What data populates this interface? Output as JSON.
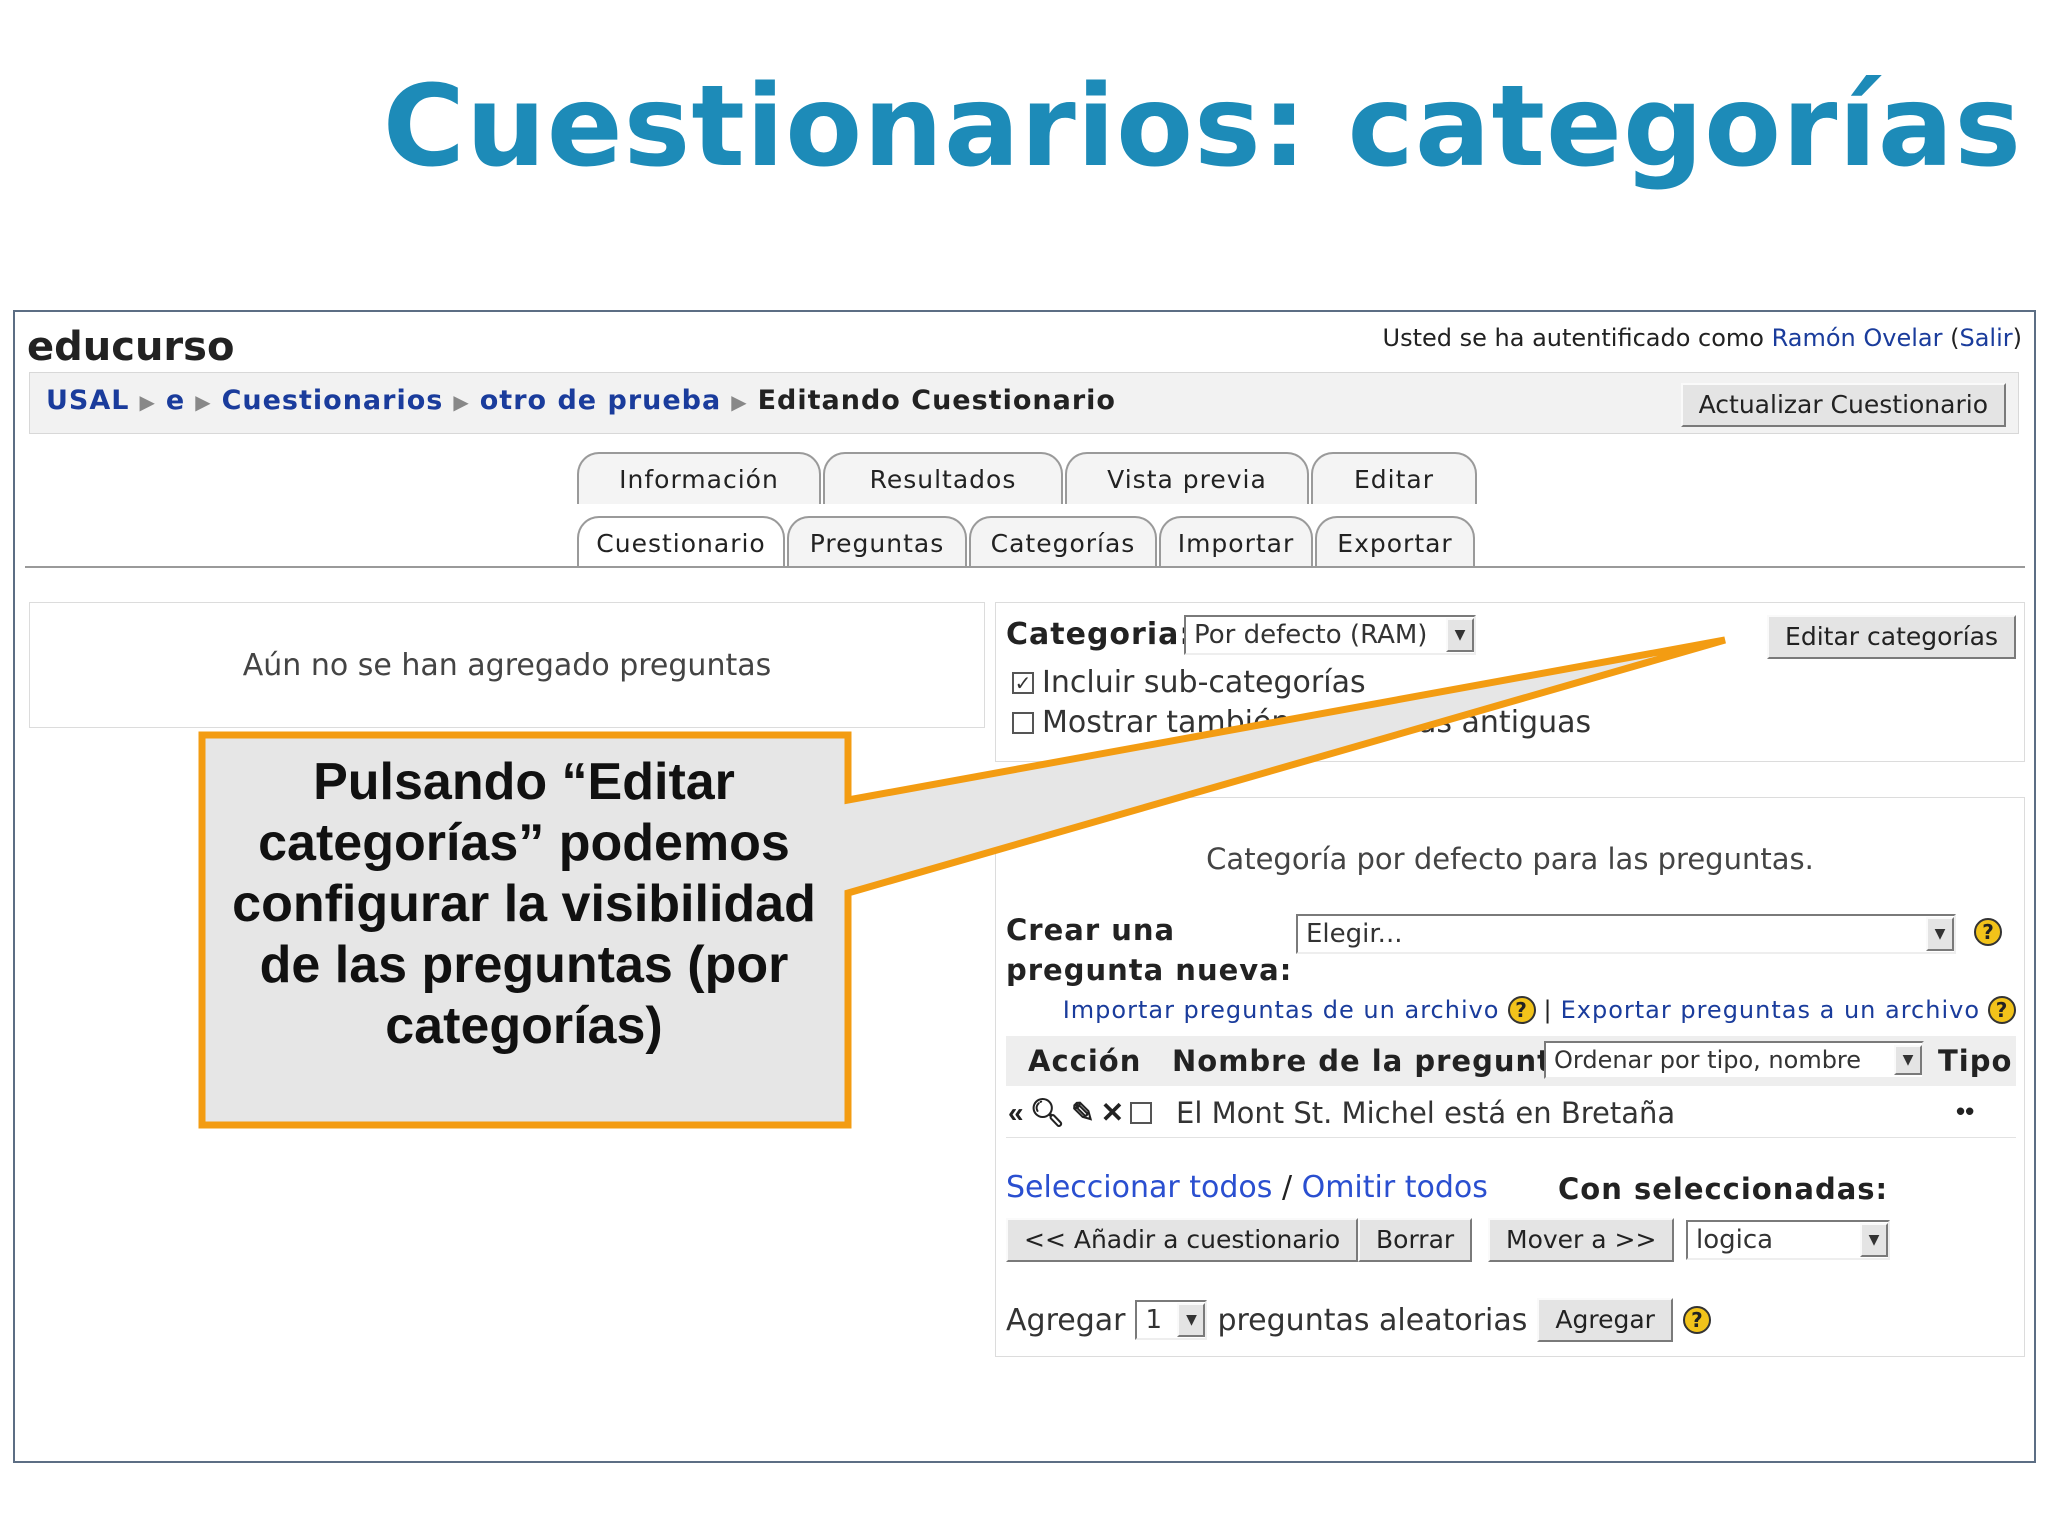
{
  "slide_title": "Cuestionarios: categorías",
  "site": {
    "name": "educurso",
    "login_prefix": "Usted se ha autentificado como",
    "user": "Ramón Ovelar",
    "logout": "Salir"
  },
  "breadcrumb": {
    "items": [
      "USAL",
      "e",
      "Cuestionarios",
      "otro de prueba"
    ],
    "current": "Editando Cuestionario",
    "separator": "▶"
  },
  "update_button": "Actualizar Cuestionario",
  "tabs_top": [
    "Información",
    "Resultados",
    "Vista previa",
    "Editar"
  ],
  "tabs_bottom": [
    "Cuestionario",
    "Preguntas",
    "Categorías",
    "Importar",
    "Exportar"
  ],
  "active_tab": "Cuestionario",
  "no_questions": "Aún no se han agregado preguntas",
  "category": {
    "label": "Categoria:",
    "selected": "Por defecto (RAM)",
    "edit_button": "Editar categorías",
    "include_sub": "Incluir sub-categorías",
    "include_sub_checked": true,
    "show_old": "Mostrar también preguntas antiguas",
    "show_old_checked": false
  },
  "questions": {
    "default_text": "Categoría por defecto para las preguntas.",
    "create_label_1": "Crear una",
    "create_label_2": "pregunta nueva:",
    "create_select": "Elegir...",
    "import_link": "Importar preguntas de un archivo",
    "export_link": "Exportar preguntas a un archivo",
    "link_separator": "|",
    "col_action": "Acción",
    "col_name": "Nombre de la pregunta",
    "sort_select": "Ordenar por tipo, nombre",
    "col_type": "Tipo",
    "rows": [
      {
        "name": "El Mont St. Michel está en Bretaña",
        "type": "••"
      }
    ],
    "select_all": "Seleccionar todos",
    "select_sep": "/",
    "deselect_all": "Omitir todos",
    "with_selected": "Con seleccionadas:",
    "add_to_quiz": "<< Añadir a cuestionario",
    "delete": "Borrar",
    "move_to": "Mover a >>",
    "move_target": "logica",
    "random_prefix": "Agregar",
    "random_count": "1",
    "random_suffix": "preguntas aleatorias",
    "random_button": "Agregar"
  },
  "callout": {
    "text": "Pulsando “Editar categorías” podemos configurar la visibilidad de las preguntas (por categorías)",
    "border_color": "#f39c12",
    "fill_color": "#e6e6e6"
  },
  "colors": {
    "title": "#1d8bb8",
    "link": "#1a3c9c",
    "help_icon": "#f2c31a"
  }
}
